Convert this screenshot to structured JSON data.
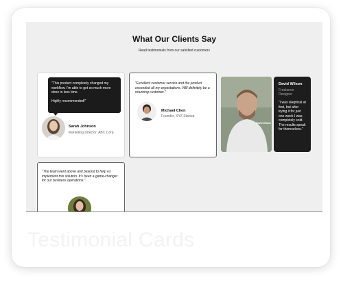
{
  "page": {
    "title": "What Our Clients Say",
    "subtitle": "Read testimonials from our satisfied customers"
  },
  "testimonials": [
    {
      "quote_line1": "\"This product completely changed my workflow. I'm able to get so much more done in less time.",
      "quote_line2": "Highly recommended!\"",
      "name": "Sarah Johnson",
      "role": "Marketing Director, ABC Corp"
    },
    {
      "quote": "\"Excellent customer service and the product exceeded all my expectations. Will definitely be a returning customer.\"",
      "name": "Michael Chen",
      "role": "Founder, XYZ Startup"
    },
    {
      "quote": "\"I was skeptical at first, but after trying it for just one week I was completely sold. The results speak for themselves.\"",
      "name": "David Wilson",
      "role": "Freelance Designer",
      "photo_caption": "David Wilson"
    },
    {
      "quote": "\"The team went above and beyond to help us implement this solution. It's been a game-changer for our business operations.\""
    }
  ],
  "watermark": "Testimonial Cards",
  "colors": {
    "background": "#efefef",
    "dark_card": "#1b1b1b",
    "text": "#111111",
    "muted": "#666666"
  }
}
